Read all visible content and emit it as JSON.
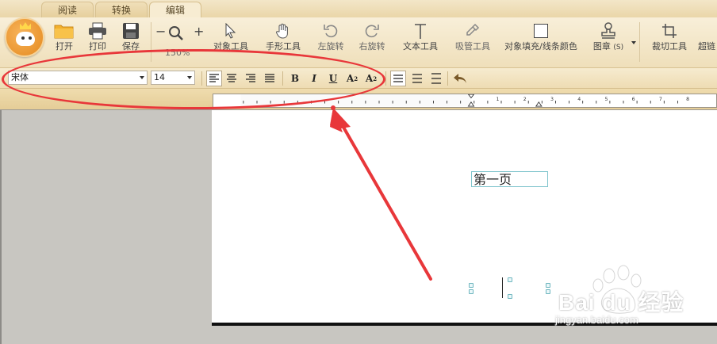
{
  "tabs": [
    {
      "label": "阅读",
      "active": false
    },
    {
      "label": "转换",
      "active": false
    },
    {
      "label": "编辑",
      "active": true
    }
  ],
  "toolbar": {
    "open_label": "打开",
    "print_label": "打印",
    "save_label": "保存",
    "zoom_minus": "−",
    "zoom_plus": "+",
    "zoom_percent": "150%",
    "object_tool": "对象工具",
    "hand_tool": "手形工具",
    "rotate_left": "左旋转",
    "rotate_right": "右旋转",
    "text_tool": "文本工具",
    "picker_tool": "吸管工具",
    "fill_line_color": "对象填充/线条颜色",
    "stamp": "图章",
    "stamp_shortcut": "(S)",
    "crop_tool": "裁切工具",
    "hyperlink_partial": "超链"
  },
  "format": {
    "font_name": "宋体",
    "font_size": "14",
    "bold": "B",
    "italic": "I",
    "underline": "U",
    "superscript": "A",
    "superscript_mark": "2",
    "subscript": "A",
    "subscript_mark": "2"
  },
  "ruler": {
    "labels": [
      "1",
      "2",
      "3",
      "4",
      "5",
      "6",
      "7",
      "8"
    ]
  },
  "document": {
    "text": "第一页"
  },
  "watermark": {
    "text": "Bai du 经验",
    "sub": "jingyan.baidu.com"
  },
  "colors": {
    "annotation_red": "#e8373a",
    "ribbon_bg": "#f3e6c8",
    "textbox_border": "#7fc4cc"
  }
}
